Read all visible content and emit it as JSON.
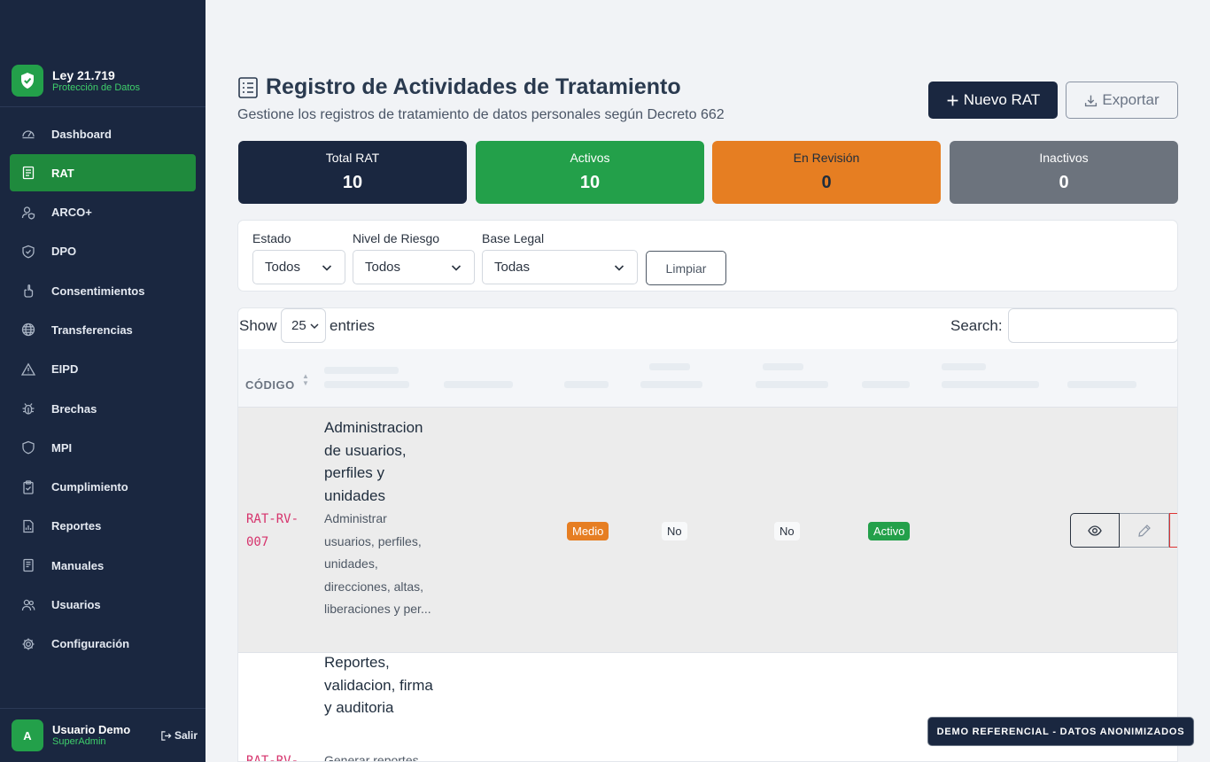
{
  "brand": {
    "title": "Ley 21.719",
    "subtitle": "Protección de Datos"
  },
  "nav": [
    {
      "label": "Dashboard",
      "icon": "gauge-icon"
    },
    {
      "label": "RAT",
      "icon": "document-list-icon",
      "active": true
    },
    {
      "label": "ARCO+",
      "icon": "user-shield-icon"
    },
    {
      "label": "DPO",
      "icon": "shield-icon"
    },
    {
      "label": "Consentimientos",
      "icon": "hand-icon"
    },
    {
      "label": "Transferencias",
      "icon": "globe-icon"
    },
    {
      "label": "EIPD",
      "icon": "warning-icon"
    },
    {
      "label": "Brechas",
      "icon": "bug-icon"
    },
    {
      "label": "MPI",
      "icon": "shield-outline-icon"
    },
    {
      "label": "Cumplimiento",
      "icon": "clipboard-check-icon"
    },
    {
      "label": "Reportes",
      "icon": "chart-file-icon"
    },
    {
      "label": "Manuales",
      "icon": "book-icon"
    },
    {
      "label": "Usuarios",
      "icon": "users-icon"
    },
    {
      "label": "Configuración",
      "icon": "gear-icon"
    }
  ],
  "user": {
    "initial": "A",
    "name": "Usuario Demo",
    "role": "SuperAdmin",
    "logout": "Salir"
  },
  "header": {
    "title": "Registro de Actividades de Tratamiento",
    "subtitle": "Gestione los registros de tratamiento de datos personales según Decreto 662",
    "new_button": "Nuevo RAT",
    "export_button": "Exportar"
  },
  "stats": [
    {
      "label": "Total RAT",
      "value": "10",
      "color": "#1a2740"
    },
    {
      "label": "Activos",
      "value": "10",
      "color": "#23a04a"
    },
    {
      "label": "En Revisión",
      "value": "0",
      "color": "#e67e22"
    },
    {
      "label": "Inactivos",
      "value": "0",
      "color": "#6c737d"
    }
  ],
  "filters": {
    "estado": {
      "label": "Estado",
      "value": "Todos"
    },
    "riesgo": {
      "label": "Nivel de Riesgo",
      "value": "Todos"
    },
    "base_legal": {
      "label": "Base Legal",
      "value": "Todas"
    },
    "clear_button": "Limpiar"
  },
  "table": {
    "show_label": "Show",
    "entries_value": "25",
    "entries_label": "entries",
    "search_label": "Search:",
    "first_column_header": "CÓDIGO",
    "rows": [
      {
        "code": "RAT-RV-007",
        "name": "Administracion de usuarios, perfiles y unidades",
        "description": "Administrar usuarios, perfiles, unidades, direcciones, altas, liberaciones y per...",
        "risk": "Medio",
        "col_sensitive": "No",
        "col_transfer": "No",
        "status": "Activo"
      },
      {
        "code": "RAT-RV-",
        "name": "Reportes, validacion, firma y auditoria",
        "description": "Generar reportes"
      }
    ]
  },
  "colors": {
    "risk_medium": "#e67e22",
    "status_active": "#23a04a",
    "sidebar": "#1a2740"
  },
  "demo_banner": "DEMO REFERENCIAL - DATOS ANONIMIZADOS"
}
